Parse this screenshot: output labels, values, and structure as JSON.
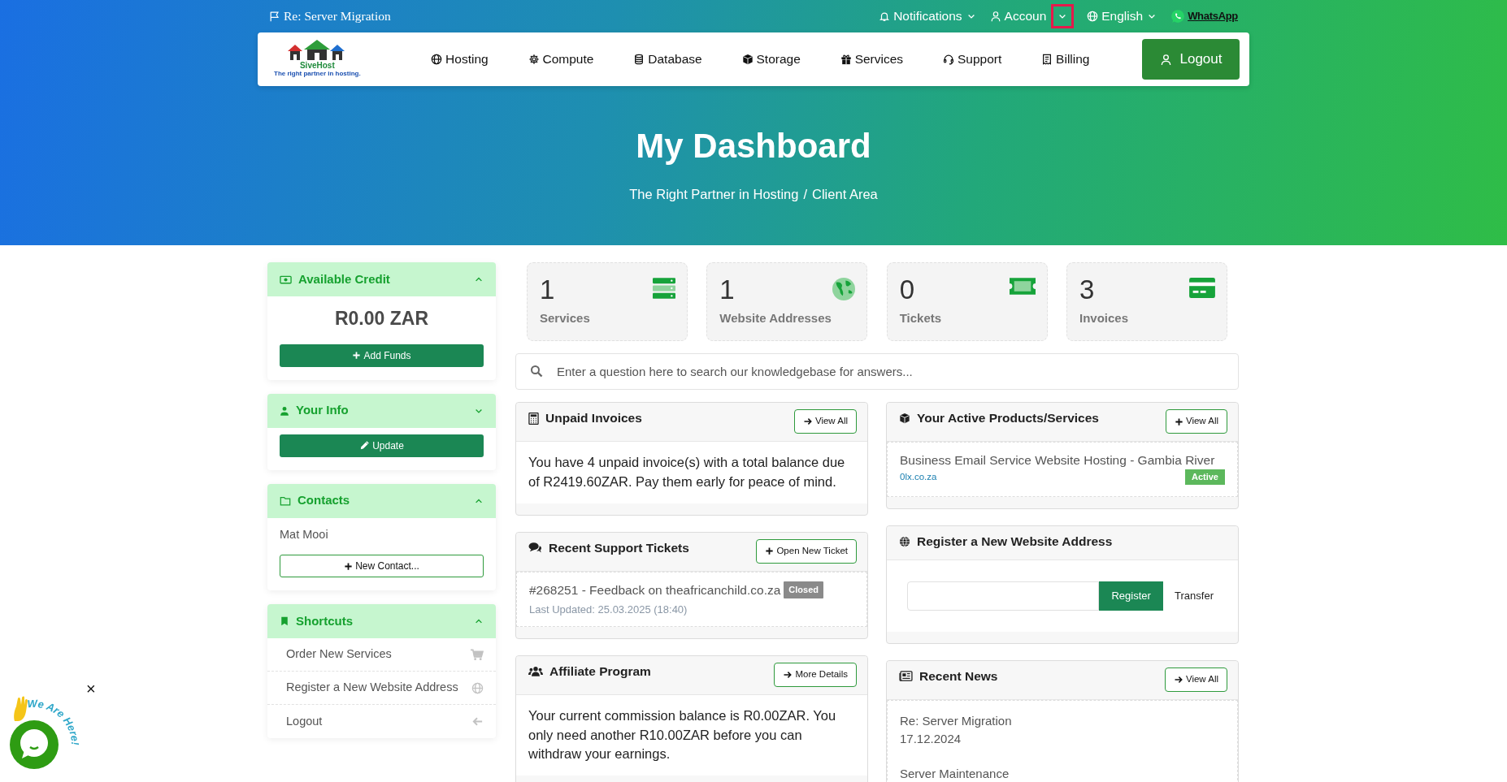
{
  "top_bar": {
    "announcement": "Re: Server Migration",
    "items": [
      {
        "kind": "dropdown",
        "label": "Notifications"
      },
      {
        "kind": "dropdown",
        "label": "Accoun",
        "highlighted": true
      },
      {
        "kind": "dropdown",
        "label": "English"
      },
      {
        "kind": "whatsapp",
        "label": "WhatsApp"
      }
    ]
  },
  "logo": {
    "name": "SiveHost",
    "tagline": "The right partner in hosting."
  },
  "nav": {
    "items": [
      "Hosting",
      "Compute",
      "Database",
      "Storage",
      "Services",
      "Support",
      "Billing"
    ],
    "logout": "Logout"
  },
  "hero": {
    "title": "My Dashboard",
    "breadcrumb": [
      "The Right Partner in Hosting",
      "Client Area"
    ],
    "separator": "/"
  },
  "sidebar": [
    {
      "kind": "credit",
      "title": "Available Credit",
      "expanded": true,
      "amount": "R0.00 ZAR",
      "button": {
        "kind": "add",
        "label": "Add Funds",
        "outline": false
      }
    },
    {
      "kind": "info",
      "title": "Your Info",
      "expanded": false,
      "button": {
        "kind": "edit",
        "label": "Update",
        "outline": false
      }
    },
    {
      "kind": "contacts",
      "title": "Contacts",
      "expanded": true,
      "contact": "Mat Mooi",
      "button": {
        "kind": "add",
        "label": "New Contact...",
        "outline": true
      }
    },
    {
      "kind": "shortcuts",
      "title": "Shortcuts",
      "expanded": true,
      "links": [
        "Order New Services",
        "Register a New Website Address",
        "Logout"
      ]
    }
  ],
  "stats": [
    {
      "count": "1",
      "label": "Services"
    },
    {
      "count": "1",
      "label": "Website Addresses"
    },
    {
      "count": "0",
      "label": "Tickets"
    },
    {
      "count": "3",
      "label": "Invoices"
    }
  ],
  "search": {
    "placeholder": "Enter a question here to search our knowledgebase for answers..."
  },
  "columns": [
    [
      {
        "kind": "text",
        "title": "Unpaid Invoices",
        "button": {
          "kind": "go",
          "label": "View All"
        },
        "text": "You have 4 unpaid invoice(s) with a total balance due of R2419.60ZAR. Pay them early for peace of mind."
      },
      {
        "kind": "ticket",
        "title": "Recent Support Tickets",
        "button": {
          "kind": "add",
          "label": "Open New Ticket"
        },
        "ticket": "#268251 - Feedback on theafricanchild.co.za",
        "status": "Closed",
        "updated": "Last Updated: 25.03.2025 (18:40)"
      },
      {
        "kind": "text",
        "title": "Affiliate Program",
        "button": {
          "kind": "go",
          "label": "More Details"
        },
        "text": "Your current commission balance is R0.00ZAR. You only need another R10.00ZAR before you can withdraw your earnings."
      }
    ],
    [
      {
        "kind": "product",
        "title": "Your Active Products/Services",
        "button": {
          "kind": "add",
          "label": "View All"
        },
        "product": "Business Email Service Website Hosting - Gambia River",
        "domain": "0lx.co.za",
        "status": "Active"
      },
      {
        "kind": "domain",
        "title": "Register a New Website Address",
        "register": "Register",
        "transfer": "Transfer"
      },
      {
        "kind": "news",
        "title": "Recent News",
        "button": {
          "kind": "go",
          "label": "View All"
        },
        "news": [
          {
            "title": "Re: Server Migration",
            "date": "17.12.2024"
          },
          {
            "title": "Server Maintenance"
          }
        ]
      }
    ]
  ],
  "chat_widget": {
    "caption": "We Are Here!",
    "close": "×"
  }
}
